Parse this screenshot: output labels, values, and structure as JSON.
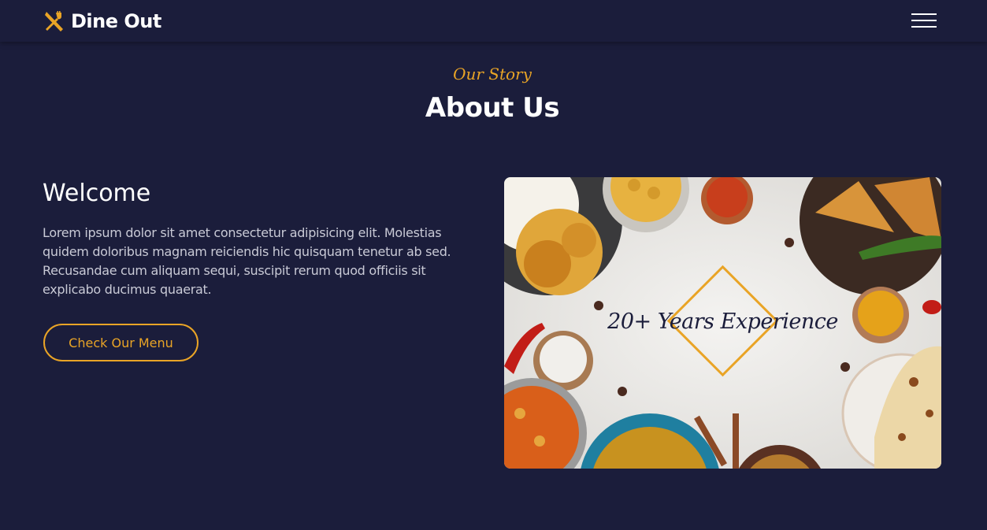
{
  "brand": {
    "name": "Dine Out",
    "icon": "fork-knife-icon",
    "accent_color": "#e9a426"
  },
  "nav": {
    "menu_icon": "hamburger-menu-icon"
  },
  "about": {
    "eyebrow": "Our Story",
    "title": "About Us",
    "welcome_title": "Welcome",
    "welcome_text": "Lorem ipsum dolor sit amet consectetur adipisicing elit. Molestias quidem doloribus magnam reiciendis hic quisquam tenetur ab sed. Recusandae cum aliquam sequi, suscipit rerum quod officiis sit explicabo ducimus quaerat.",
    "menu_button": "Check Our Menu",
    "experience_badge": "20+ Years Experience"
  },
  "colors": {
    "background": "#1b1d3b",
    "accent": "#e9a426",
    "body_text": "#c9cad6"
  }
}
